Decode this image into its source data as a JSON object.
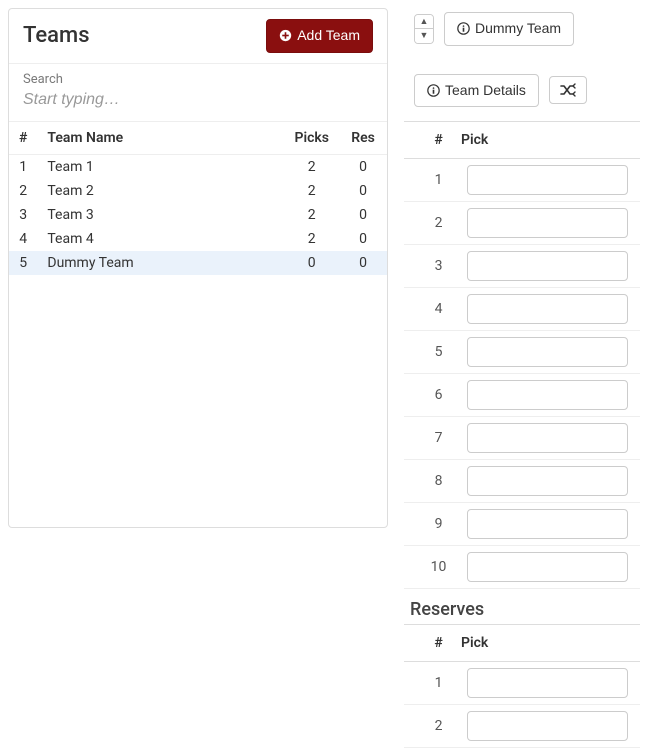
{
  "teams_panel": {
    "title": "Teams",
    "add_button_label": "Add Team",
    "search_label": "Search",
    "search_placeholder": "Start typing…",
    "headers": {
      "num": "#",
      "name": "Team Name",
      "picks": "Picks",
      "res": "Res"
    },
    "rows": [
      {
        "num": "1",
        "name": "Team 1",
        "picks": "2",
        "res": "0",
        "selected": false
      },
      {
        "num": "2",
        "name": "Team 2",
        "picks": "2",
        "res": "0",
        "selected": false
      },
      {
        "num": "3",
        "name": "Team 3",
        "picks": "2",
        "res": "0",
        "selected": false
      },
      {
        "num": "4",
        "name": "Team 4",
        "picks": "2",
        "res": "0",
        "selected": false
      },
      {
        "num": "5",
        "name": "Dummy Team",
        "picks": "0",
        "res": "0",
        "selected": true
      }
    ]
  },
  "detail_panel": {
    "current_team_label": "Dummy Team",
    "team_details_label": "Team Details",
    "picks_header_num": "#",
    "picks_header_pick": "Pick",
    "pick_rows": [
      {
        "num": "1",
        "value": ""
      },
      {
        "num": "2",
        "value": ""
      },
      {
        "num": "3",
        "value": ""
      },
      {
        "num": "4",
        "value": ""
      },
      {
        "num": "5",
        "value": ""
      },
      {
        "num": "6",
        "value": ""
      },
      {
        "num": "7",
        "value": ""
      },
      {
        "num": "8",
        "value": ""
      },
      {
        "num": "9",
        "value": ""
      },
      {
        "num": "10",
        "value": ""
      }
    ],
    "reserves_title": "Reserves",
    "reserves_header_num": "#",
    "reserves_header_pick": "Pick",
    "reserve_rows": [
      {
        "num": "1",
        "value": ""
      },
      {
        "num": "2",
        "value": ""
      }
    ]
  }
}
